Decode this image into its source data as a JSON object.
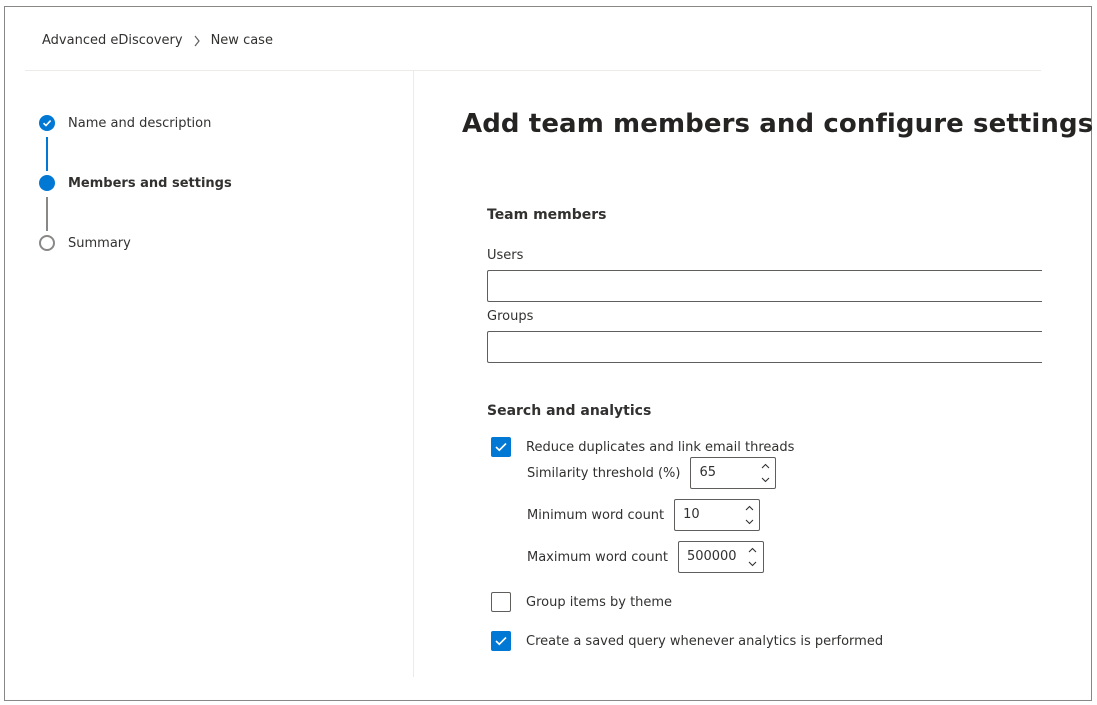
{
  "breadcrumb": {
    "items": [
      "Advanced eDiscovery",
      "New case"
    ]
  },
  "steps": [
    {
      "label": "Name and description",
      "state": "done"
    },
    {
      "label": "Members and settings",
      "state": "current"
    },
    {
      "label": "Summary",
      "state": "pending"
    }
  ],
  "page": {
    "title": "Add team members and configure settings"
  },
  "team_members": {
    "heading": "Team members",
    "users_label": "Users",
    "users_value": "",
    "groups_label": "Groups",
    "groups_value": ""
  },
  "search_analytics": {
    "heading": "Search and analytics",
    "reduce_duplicates": {
      "label": "Reduce duplicates and link email threads",
      "checked": true
    },
    "similarity_threshold": {
      "label": "Similarity threshold (%)",
      "value": "65"
    },
    "min_word_count": {
      "label": "Minimum word count",
      "value": "10"
    },
    "max_word_count": {
      "label": "Maximum word count",
      "value": "500000"
    },
    "group_by_theme": {
      "label": "Group items by theme",
      "checked": false
    },
    "saved_query": {
      "label": "Create a saved query whenever analytics is performed",
      "checked": true
    }
  },
  "colors": {
    "accent": "#0078d4",
    "text": "#323130",
    "border": "#605e5c",
    "divider": "#edebe9"
  }
}
